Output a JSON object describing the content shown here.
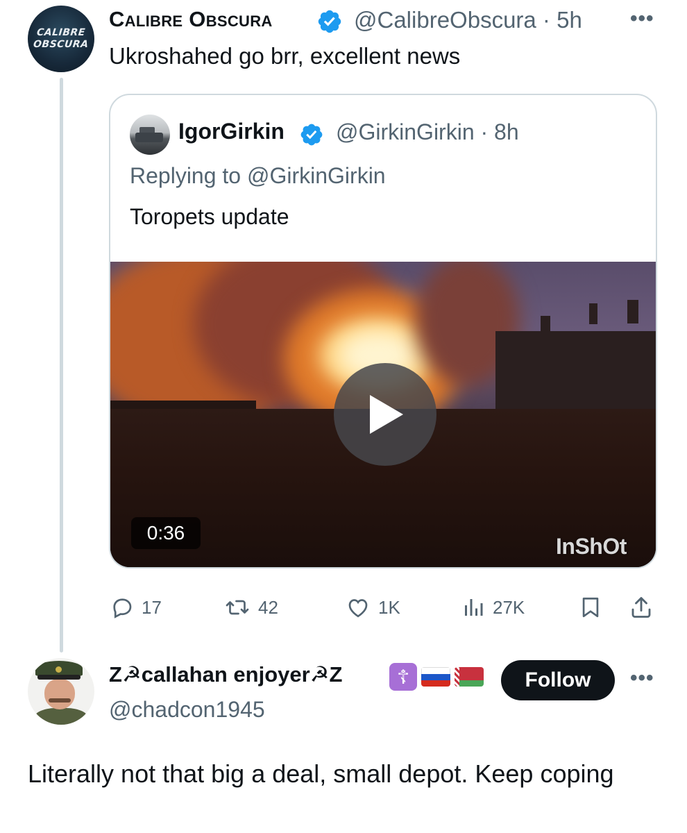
{
  "tweet": {
    "avatar_text_line1": "CALIBRE",
    "avatar_text_line2": "OBSCURA",
    "author_name": "Calibre Obscura",
    "handle_time": "@CalibreObscura · 5h",
    "more_icon": "more-dots-icon",
    "text": "Ukroshahed go brr, excellent news",
    "verified_color": "#1d9bf0"
  },
  "quoted": {
    "author_name": "IgorGirkin",
    "handle_time": "@GirkinGirkin · 8h",
    "replying_to": "Replying to @GirkinGirkin",
    "text": "Toropets update",
    "video": {
      "duration": "0:36",
      "watermark": "InShOt",
      "play_icon": "play-icon"
    }
  },
  "actions": {
    "replies": "17",
    "retweets": "42",
    "likes": "1K",
    "views": "27K",
    "icons": [
      "reply-icon",
      "retweet-icon",
      "like-icon",
      "views-icon",
      "bookmark-icon",
      "share-icon"
    ]
  },
  "reply": {
    "author_name": "Z☭callahan enjoyer☭Z",
    "handle": "@chadcon1945",
    "follow_label": "Follow",
    "text": "Literally not that big a deal, small depot. Keep coping",
    "cross_glyph": "☦",
    "flag_icons": [
      "russia-flag-icon",
      "belarus-flag-icon"
    ]
  },
  "colors": {
    "text_primary": "#0f1419",
    "text_secondary": "#536471",
    "border": "#cfd9de",
    "verified": "#1d9bf0",
    "follow_bg": "#0f1419"
  }
}
